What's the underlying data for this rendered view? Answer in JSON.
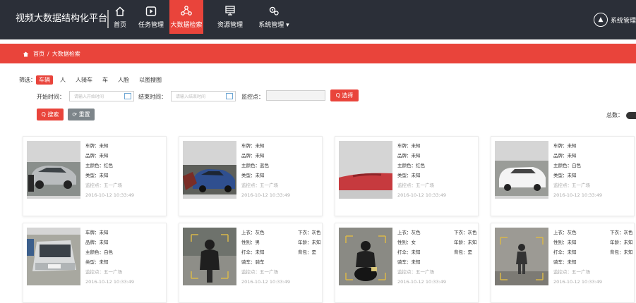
{
  "app": {
    "title": "视频大数据结构化平台"
  },
  "nav": [
    {
      "label": "首页",
      "icon": "home-icon"
    },
    {
      "label": "任务管理",
      "icon": "play-icon"
    },
    {
      "label": "大数据检索",
      "icon": "search-graph-icon"
    },
    {
      "label": "资源管理",
      "icon": "monitor-icon"
    },
    {
      "label": "系统管理 ▾",
      "icon": "settings-icon"
    }
  ],
  "user": {
    "label": "系统管理"
  },
  "breadcrumb": {
    "home": "首页",
    "sep": "/",
    "current": "大数据检索"
  },
  "filter": {
    "label": "筛选：",
    "tags": [
      "车辆",
      "人",
      "人骑车",
      "车",
      "人脸",
      "以图搜图"
    ],
    "selected": "车辆"
  },
  "form": {
    "start_label": "开始时间：",
    "start_placeholder": "请输入开始时间",
    "end_label": "结束时间：",
    "end_placeholder": "请输入结束时间",
    "monitor_label": "监控点：",
    "select_btn": "Q 选择",
    "search_btn": "Q 搜索",
    "reset_btn": "⟳ 重置"
  },
  "total": {
    "label": "总数："
  },
  "results": [
    {
      "lines": [
        [
          "车牌：未知"
        ],
        [
          "品牌：未知"
        ],
        [
          "主颜色：红色"
        ],
        [
          "类型：未知"
        ]
      ],
      "location": "监控点：五一广场",
      "time": "2016-10-12 10:33:49"
    },
    {
      "lines": [
        [
          "车牌：未知"
        ],
        [
          "品牌：未知"
        ],
        [
          "主颜色：蓝色"
        ],
        [
          "类型：未知"
        ]
      ],
      "location": "监控点：五一广场",
      "time": "2016-10-12 10:33:49"
    },
    {
      "lines": [
        [
          "车牌：未知"
        ],
        [
          "品牌：未知"
        ],
        [
          "主颜色：红色"
        ],
        [
          "类型：未知"
        ]
      ],
      "location": "监控点：五一广场",
      "time": "2016-10-12 10:33:49"
    },
    {
      "lines": [
        [
          "车牌：未知"
        ],
        [
          "品牌：未知"
        ],
        [
          "主颜色：白色"
        ],
        [
          "类型：未知"
        ]
      ],
      "location": "监控点：五一广场",
      "time": "2016-10-12 10:33:49"
    },
    {
      "lines": [
        [
          "车牌：未知"
        ],
        [
          "品牌：未知"
        ],
        [
          "主颜色：白色"
        ],
        [
          "类型：未知"
        ]
      ],
      "location": "监控点：五一广场",
      "time": "2016-10-12 10:33:49"
    },
    {
      "lines": [
        [
          "上衣：灰色",
          "下衣：灰色"
        ],
        [
          "性别：男",
          "年龄：未知"
        ],
        [
          "打伞：未知",
          "背包：是"
        ],
        [
          "骑车：骑车"
        ]
      ],
      "location": "监控点：五一广场",
      "time": "2016-10-12 10:33:49"
    },
    {
      "lines": [
        [
          "上衣：灰色",
          "下衣：灰色"
        ],
        [
          "性别：女",
          "年龄：未知"
        ],
        [
          "打伞：未知",
          "背包：是"
        ],
        [
          "骑车：未知"
        ]
      ],
      "location": "监控点：五一广场",
      "time": "2016-10-12 10:33:49"
    },
    {
      "lines": [
        [
          "上衣：灰色",
          "下衣：灰色"
        ],
        [
          "性别：未知",
          "年龄：未知"
        ],
        [
          "打伞：未知",
          "背包：未知"
        ],
        [
          "骑车：未知"
        ]
      ],
      "location": "监控点：五一广场",
      "time": "2016-10-12 10:33:49"
    }
  ],
  "colors": {
    "accent": "#e9443b",
    "topbar": "#2b2f38",
    "reset": "#7d858a"
  }
}
